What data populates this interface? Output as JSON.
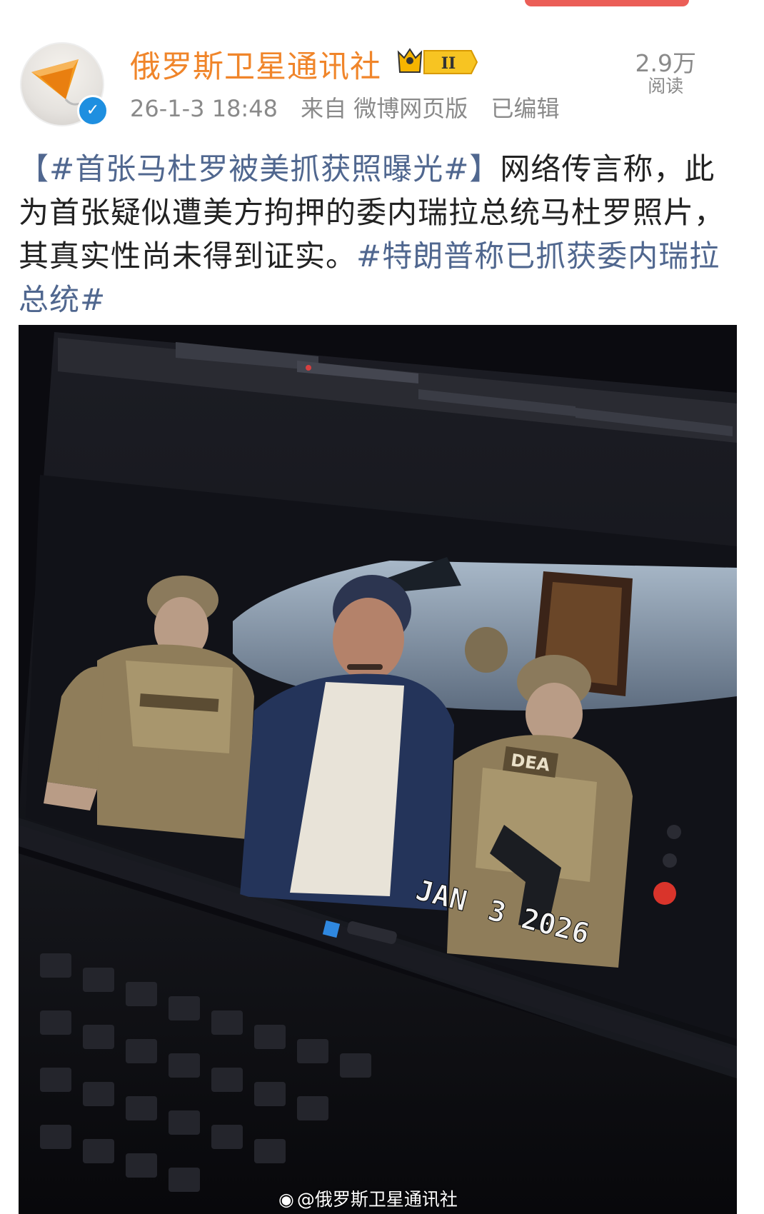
{
  "post": {
    "author": {
      "name": "俄罗斯卫星通讯社",
      "level_badge": "II",
      "verified": true
    },
    "timestamp": "26-1-3 18:48",
    "source": "来自 微博网页版",
    "edited": "已编辑",
    "reads": {
      "count": "2.9万",
      "label": "阅读"
    },
    "text": {
      "topic1": "【#首张马杜罗被美抓获照曝光#】",
      "body": "网络传言称，此为首张疑似遭美方拘押的委内瑞拉总统马杜罗照片，其真实性尚未得到证实。",
      "topic2": "#特朗普称已抓获委内瑞拉总统#"
    },
    "image": {
      "overlay_text_1": "JAN",
      "overlay_text_2": "3 2026",
      "vest_patch": "DEA",
      "watermark": "@俄罗斯卫星通讯社"
    }
  },
  "colors": {
    "username": "#f0852a",
    "topic_link": "#50678f",
    "meta_gray": "#8a8a8a",
    "verified_blue": "#1e8fe0"
  }
}
